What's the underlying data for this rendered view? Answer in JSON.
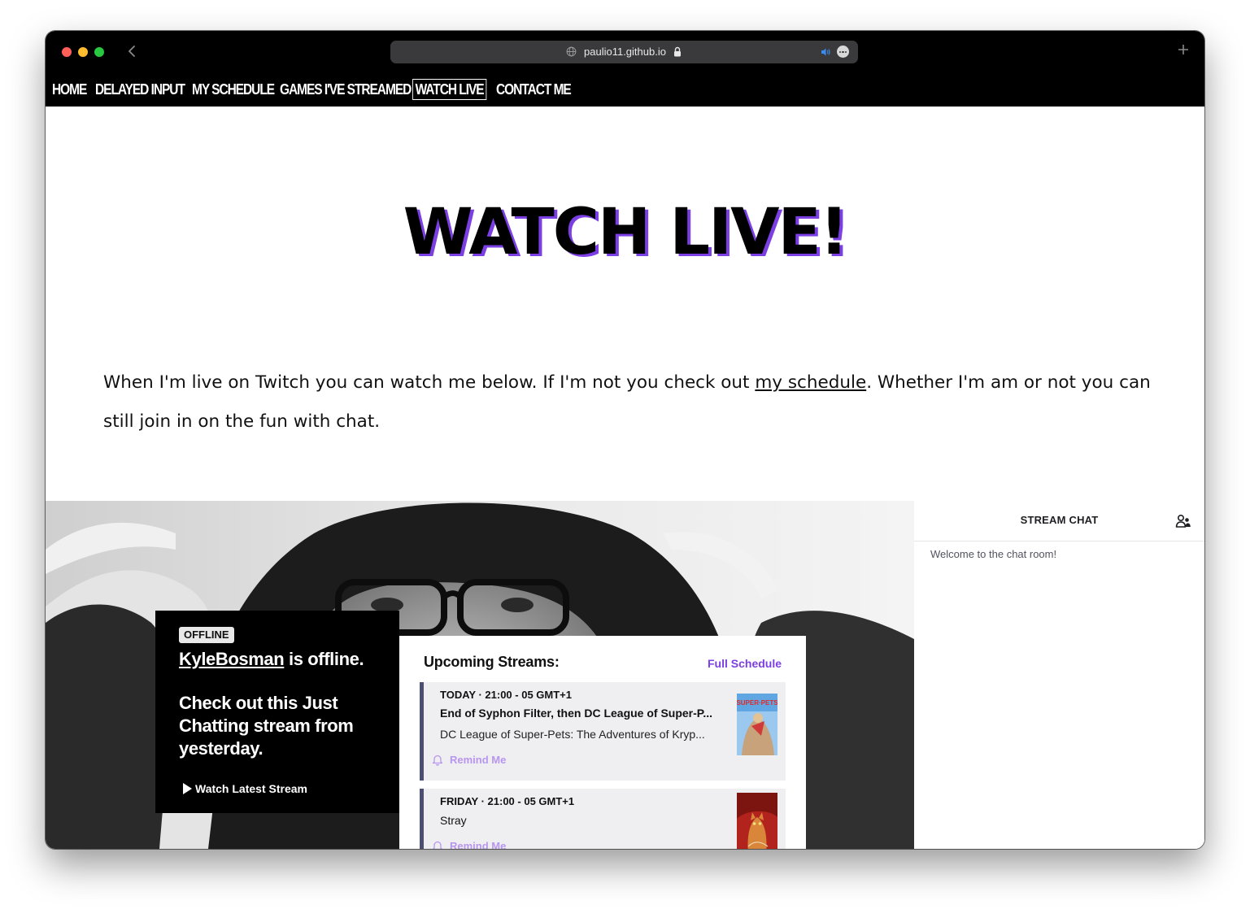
{
  "browser": {
    "url": "paulio11.github.io"
  },
  "nav": {
    "items": [
      "HOME",
      "DELAYED INPUT",
      "MY SCHEDULE",
      "GAMES I'VE STREAMED",
      "WATCH LIVE",
      "CONTACT ME"
    ],
    "active": "WATCH LIVE"
  },
  "hero": {
    "title": "WATCH LIVE!"
  },
  "intro": {
    "before_link": "When I'm live on Twitch you can watch me below. If I'm not you check out ",
    "link_text": "my schedule",
    "after_link": ". Whether I'm am or not you can still join in on the fun with chat."
  },
  "player": {
    "offline_badge": "OFFLINE",
    "channel": "KyleBosman",
    "offline_suffix": " is offline.",
    "message": "Check out this Just Chatting stream from yesterday.",
    "watch_latest": "Watch Latest Stream"
  },
  "schedule": {
    "title": "Upcoming Streams:",
    "full_link": "Full Schedule",
    "items": [
      {
        "day": "TODAY",
        "time": "21:00 - 05 GMT+1",
        "name": "End of Syphon Filter, then DC League of Super-P...",
        "game": "DC League of Super-Pets: The Adventures of Kryp...",
        "remind": "Remind Me"
      },
      {
        "day": "FRIDAY",
        "time": "21:00 - 05 GMT+1",
        "name": "Stray",
        "remind": "Remind Me"
      }
    ]
  },
  "chat": {
    "title": "STREAM CHAT",
    "welcome": "Welcome to the chat room!"
  },
  "colors": {
    "accent_purple": "#7b3fe4",
    "remind_purple": "#b896ee",
    "nav_bg": "#000000"
  }
}
